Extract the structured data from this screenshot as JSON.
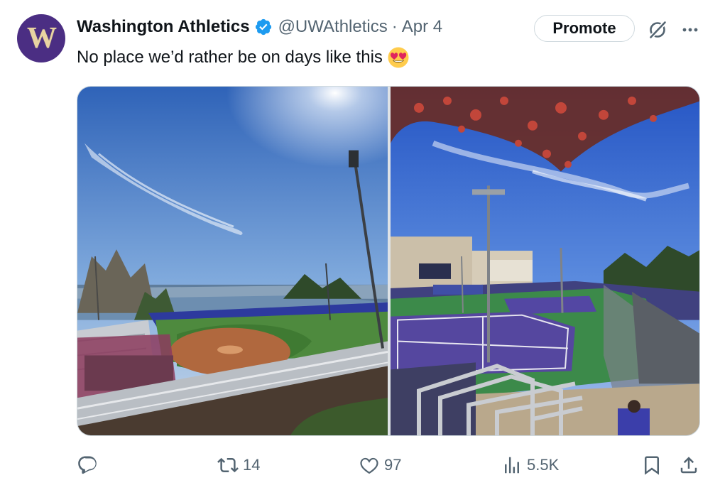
{
  "tweet": {
    "avatar_letter": "W",
    "display_name": "Washington Athletics",
    "handle": "@UWAthletics",
    "separator": "·",
    "date": "Apr 4",
    "text": "No place we’d rather be on days like this",
    "emoji": "heart-eyes-emoji",
    "promote_label": "Promote"
  },
  "media": {
    "left_photo": "softball-stadium-photo",
    "right_photo": "tennis-courts-photo"
  },
  "actions": {
    "reply_count": "",
    "retweet_count": "14",
    "like_count": "97",
    "view_count": "5.5K"
  },
  "colors": {
    "brand_purple": "#4b2e83",
    "brand_gold": "#e8d3a2",
    "verified_blue": "#1d9bf0",
    "muted_text": "#536471",
    "border": "#cfd9de"
  },
  "icons": [
    "verified-badge-icon",
    "grok-icon",
    "more-icon",
    "reply-icon",
    "retweet-icon",
    "like-icon",
    "views-icon",
    "bookmark-icon",
    "share-icon"
  ]
}
